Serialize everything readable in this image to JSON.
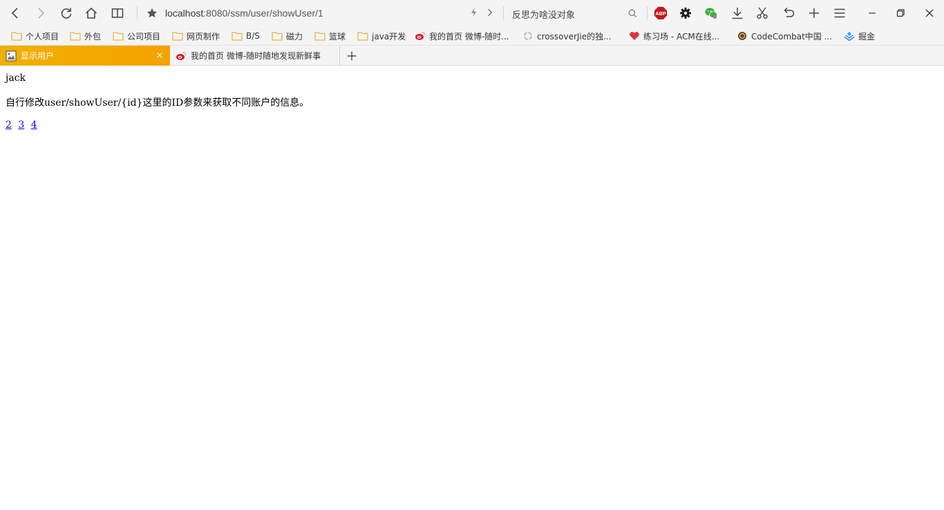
{
  "toolbar": {
    "address": {
      "host": "localhost",
      "path": ":8080/ssm/user/showUser/1"
    },
    "search": {
      "text": "反思为啥没对象"
    },
    "icons": [
      "back-icon",
      "forward-icon",
      "reload-icon",
      "home-icon",
      "reader-icon",
      "star-icon",
      "bolt-icon",
      "chevron-right-icon",
      "search-icon",
      "adblock-icon",
      "gear-icon",
      "wechat-icon",
      "download-icon",
      "scissors-icon",
      "undo-icon",
      "plus-icon",
      "menu-icon",
      "minimize-icon",
      "restore-icon",
      "close-icon"
    ],
    "adblock_label": "ABP"
  },
  "bookmarks": [
    {
      "label": "个人项目",
      "icon": "folder-icon"
    },
    {
      "label": "外包",
      "icon": "folder-icon"
    },
    {
      "label": "公司项目",
      "icon": "folder-icon"
    },
    {
      "label": "网页制作",
      "icon": "folder-icon"
    },
    {
      "label": "B/S",
      "icon": "folder-icon"
    },
    {
      "label": "磁力",
      "icon": "folder-icon"
    },
    {
      "label": "篮球",
      "icon": "folder-icon"
    },
    {
      "label": "java开发",
      "icon": "folder-icon"
    },
    {
      "label": "我的首页 微博-随时...",
      "icon": "weibo-icon"
    },
    {
      "label": "crossoverJie的独...",
      "icon": "recycle-icon"
    },
    {
      "label": "练习场 - ACM在线...",
      "icon": "heart-icon"
    },
    {
      "label": "CodeCombat中国 ...",
      "icon": "codecombat-icon"
    },
    {
      "label": "掘金",
      "icon": "juejin-icon"
    }
  ],
  "tabs": [
    {
      "label": "显示用户",
      "active": true
    },
    {
      "label": "我的首页 微博-随时随地发现新鲜事",
      "active": false
    }
  ],
  "page": {
    "username": "jack",
    "hint": "自行修改user/showUser/{id}这里的ID参数来获取不同账户的信息。",
    "links": [
      "2",
      "3",
      "4"
    ]
  },
  "colors": {
    "active_tab": "#f0b000",
    "link": "#0000ee",
    "adblock": "#c4161c",
    "heart": "#e0323c",
    "folder": "#e6b540"
  }
}
